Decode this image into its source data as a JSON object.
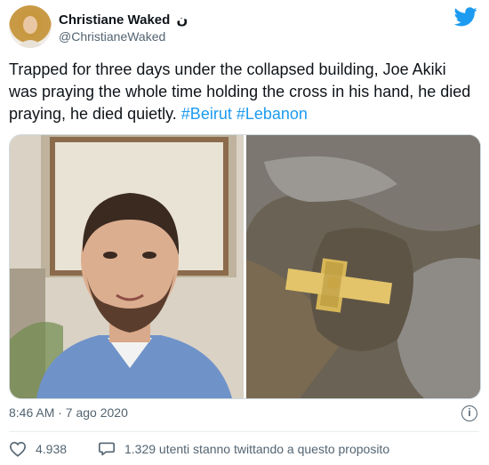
{
  "tweet": {
    "author_name": "Christiane Waked",
    "author_badge": "ن",
    "handle": "@ChristianeWaked",
    "text_main": "Trapped for three days under the collapsed building, Joe Akiki was praying the whole time holding the cross in his hand, he died praying, he died quietly. ",
    "hashtags": [
      "#Beirut",
      "#Lebanon"
    ],
    "timestamp": "8:46 AM · 7 ago 2020",
    "like_count": "4.938",
    "conversation_text": "1.329 utenti stanno twittando a questo proposito",
    "info_glyph": "i"
  },
  "icons": {
    "brand": "twitter-bird-icon",
    "like": "heart-icon",
    "reply": "speech-bubble-icon",
    "info": "info-icon"
  },
  "colors": {
    "link": "#1d9bf0",
    "secondary_text": "#536471",
    "primary_text": "#0f1419"
  }
}
